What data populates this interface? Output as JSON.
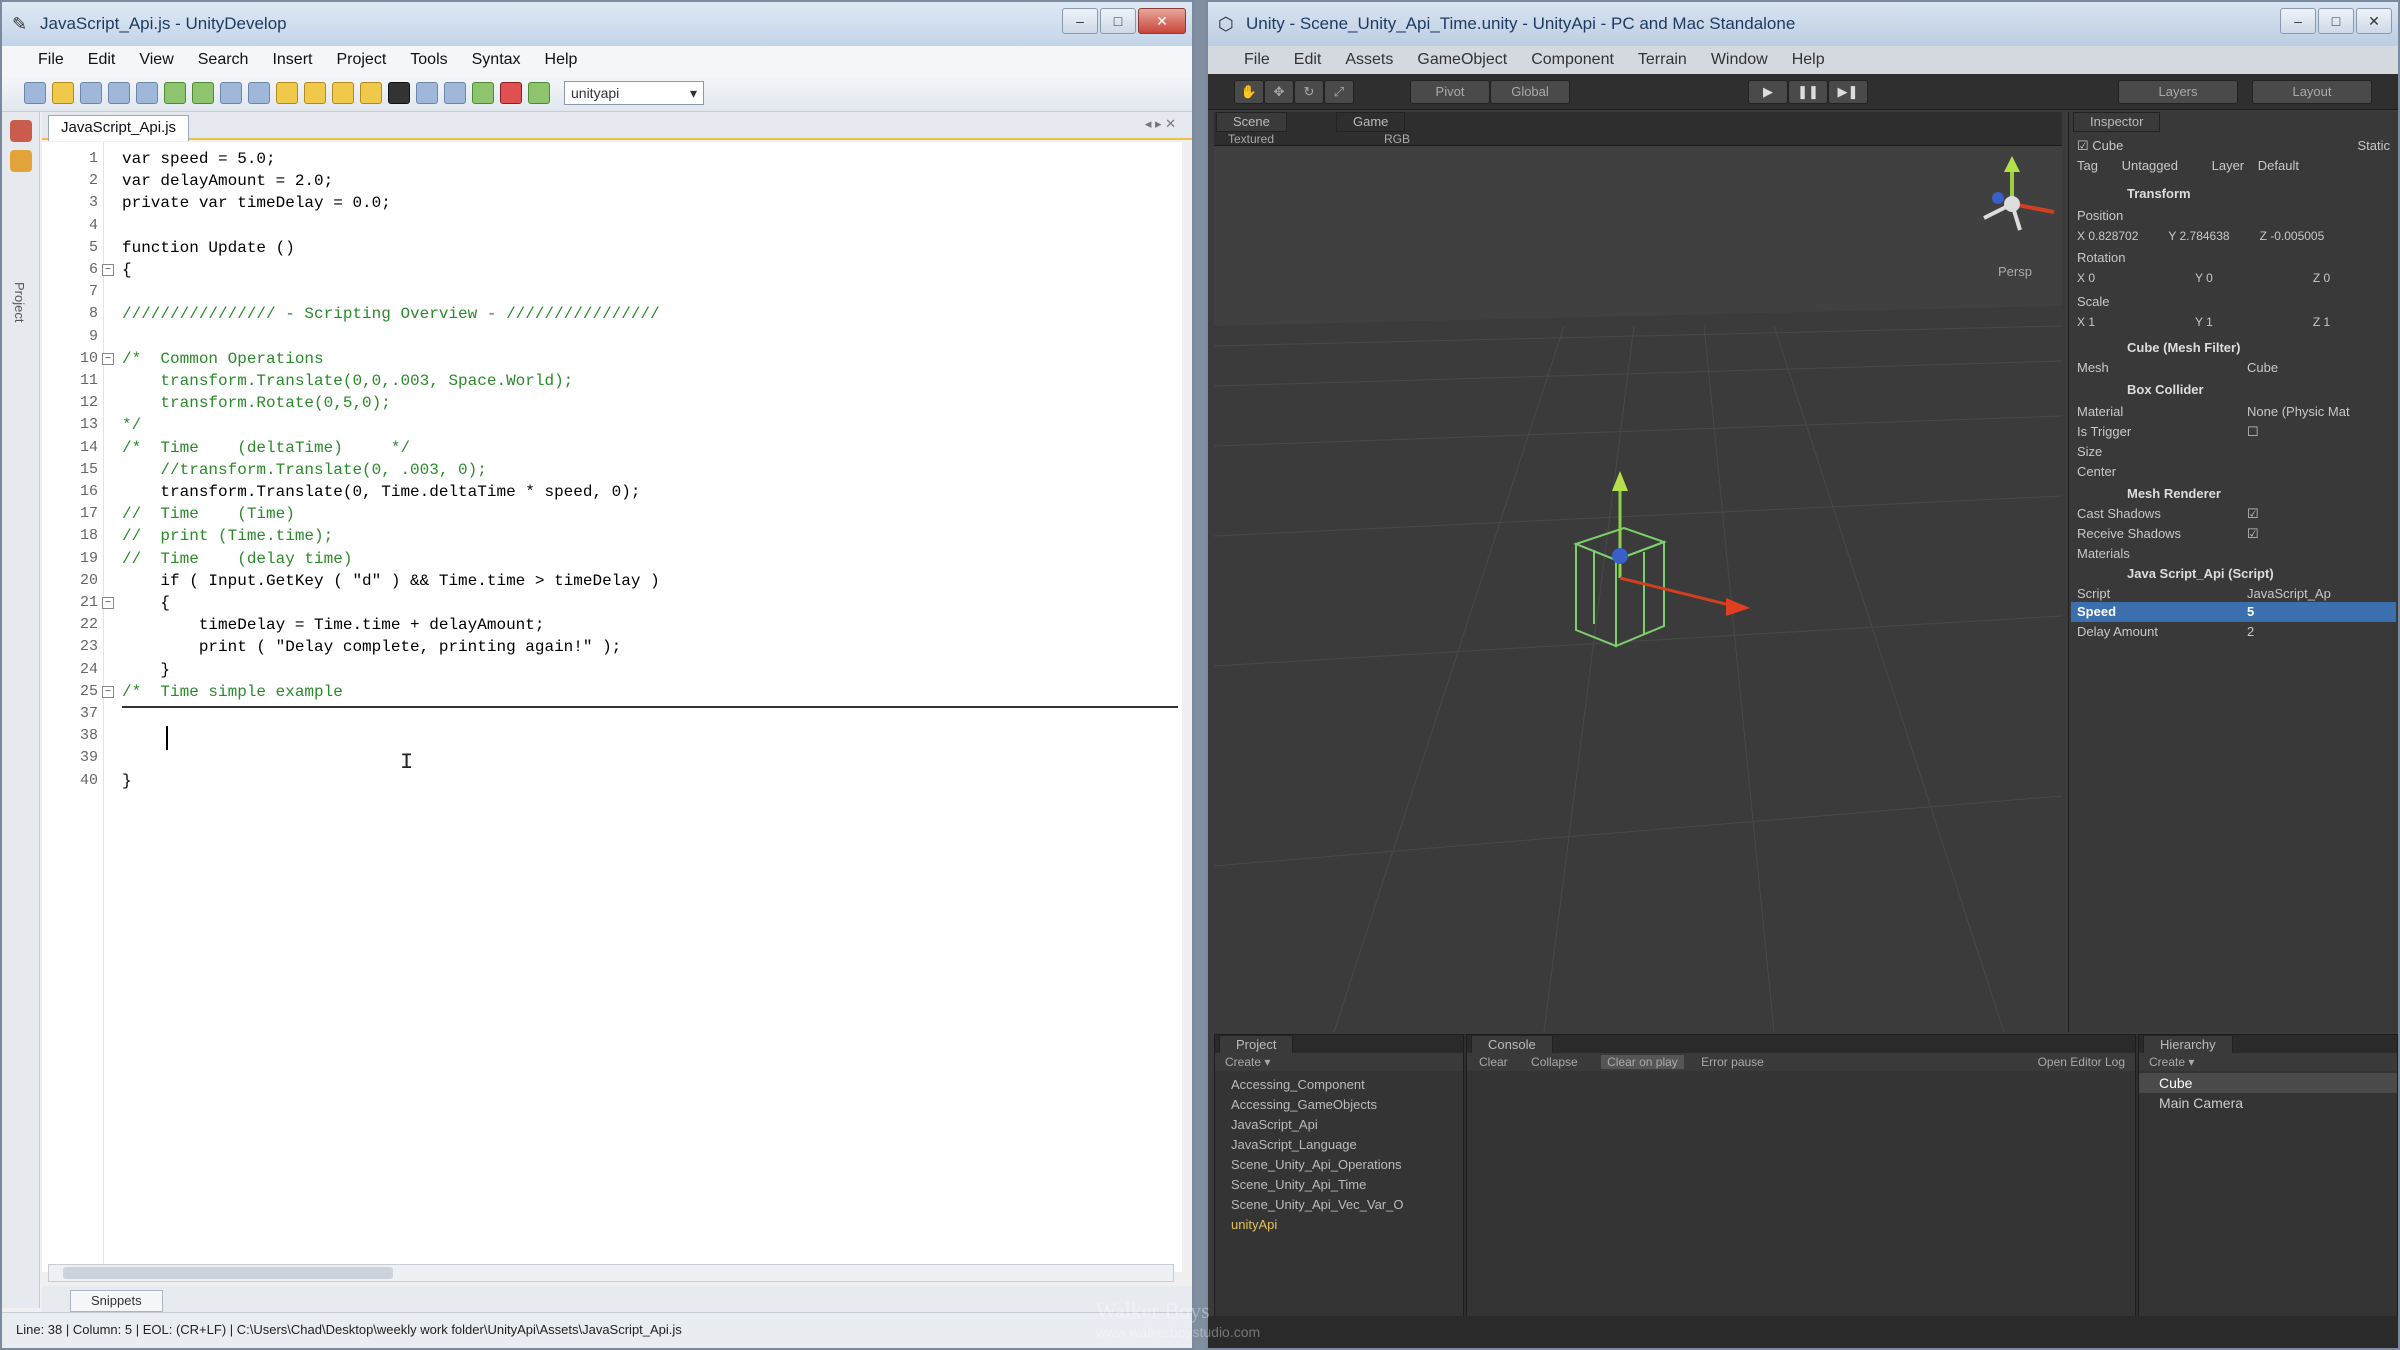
{
  "ultradev": {
    "title": "JavaScript_Api.js - UnityDevelop",
    "menu": [
      "File",
      "Edit",
      "View",
      "Search",
      "Insert",
      "Project",
      "Tools",
      "Syntax",
      "Help"
    ],
    "toolbar_select": "unityapi",
    "tab": "JavaScript_Api.js",
    "side_label": "Project",
    "code_lines": [
      {
        "n": "1",
        "t": "var speed = 5.0;"
      },
      {
        "n": "2",
        "t": "var delayAmount = 2.0;"
      },
      {
        "n": "3",
        "t": "private var timeDelay = 0.0;"
      },
      {
        "n": "4",
        "t": ""
      },
      {
        "n": "5",
        "t": "function Update ()"
      },
      {
        "n": "6",
        "t": "{"
      },
      {
        "n": "7",
        "t": ""
      },
      {
        "n": "8",
        "t": "//////////////// - Scripting Overview - ////////////////"
      },
      {
        "n": "9",
        "t": ""
      },
      {
        "n": "10",
        "t": "/*  Common Operations"
      },
      {
        "n": "11",
        "t": "    transform.Translate(0,0,.003, Space.World);"
      },
      {
        "n": "12",
        "t": "    transform.Rotate(0,5,0);"
      },
      {
        "n": "13",
        "t": "*/"
      },
      {
        "n": "14",
        "t": "/*  Time    (deltaTime)     */"
      },
      {
        "n": "15",
        "t": "    //transform.Translate(0, .003, 0);"
      },
      {
        "n": "16",
        "t": "    transform.Translate(0, Time.deltaTime * speed, 0);"
      },
      {
        "n": "17",
        "t": "//  Time    (Time)"
      },
      {
        "n": "18",
        "t": "//  print (Time.time);"
      },
      {
        "n": "19",
        "t": "//  Time    (delay time)"
      },
      {
        "n": "20",
        "t": "    if ( Input.GetKey ( \"d\" ) && Time.time > timeDelay )"
      },
      {
        "n": "21",
        "t": "    {"
      },
      {
        "n": "22",
        "t": "        timeDelay = Time.time + delayAmount;"
      },
      {
        "n": "23",
        "t": "        print ( \"Delay complete, printing again!\" );"
      },
      {
        "n": "24",
        "t": "    }"
      },
      {
        "n": "25",
        "t": "/*  Time simple example"
      },
      {
        "n": "37",
        "t": ""
      },
      {
        "n": "38",
        "t": ""
      },
      {
        "n": "39",
        "t": ""
      },
      {
        "n": "40",
        "t": "}"
      }
    ],
    "output_tab": "Snippets",
    "status": "Line: 38  |  Column: 5  |  EOL: (CR+LF)  |  C:\\Users\\Chad\\Desktop\\weekly work folder\\UnityApi\\Assets\\JavaScript_Api.js"
  },
  "unity": {
    "title": "Unity - Scene_Unity_Api_Time.unity - UnityApi - PC and Mac Standalone",
    "menu": [
      "File",
      "Edit",
      "Assets",
      "GameObject",
      "Component",
      "Terrain",
      "Window",
      "Help"
    ],
    "toolbar": {
      "pivot": "Pivot",
      "global": "Global",
      "layers": "Layers",
      "layout": "Layout"
    },
    "scene_tabs": [
      "Scene",
      "Game"
    ],
    "scene_controls": [
      "Textured",
      "RGB"
    ],
    "persp_label": "Persp",
    "inspector": {
      "tab": "Inspector",
      "object": "Cube",
      "static": "Static",
      "tag_label": "Tag",
      "tag": "Untagged",
      "layer_label": "Layer",
      "layer": "Default",
      "transform": "Transform",
      "position_label": "Position",
      "position": [
        "X 0.828702",
        "Y 2.784638",
        "Z -0.005005"
      ],
      "rotation_label": "Rotation",
      "rotation": [
        "X 0",
        "Y 0",
        "Z 0"
      ],
      "scale_label": "Scale",
      "scale": [
        "X 1",
        "Y 1",
        "Z 1"
      ],
      "mesh_filter": "Cube (Mesh Filter)",
      "mesh_label": "Mesh",
      "mesh": "Cube",
      "box_collider": "Box Collider",
      "material_label": "Material",
      "material": "None (Physic Mat",
      "trigger_label": "Is Trigger",
      "size_label": "Size",
      "center_label": "Center",
      "mesh_renderer": "Mesh Renderer",
      "cast_label": "Cast Shadows",
      "receive_label": "Receive Shadows",
      "materials_label": "Materials",
      "script_comp": "Java Script_Api (Script)",
      "script_label": "Script",
      "script": "JavaScript_Ap",
      "speed_label": "Speed",
      "speed": "5",
      "delay_label": "Delay Amount",
      "delay": "2"
    },
    "project": {
      "tab": "Project",
      "create": "Create ▾",
      "items": [
        "Accessing_Component",
        "Accessing_GameObjects",
        "JavaScript_Api",
        "JavaScript_Language",
        "Scene_Unity_Api_Operations",
        "Scene_Unity_Api_Time",
        "Scene_Unity_Api_Vec_Var_O",
        "unityApi"
      ]
    },
    "console": {
      "tab": "Console",
      "buttons": [
        "Clear",
        "Collapse",
        "Clear on play",
        "Error pause"
      ],
      "right": "Open Editor Log"
    },
    "hierarchy": {
      "tab": "Hierarchy",
      "create": "Create ▾",
      "items": [
        "Cube",
        "Main Camera"
      ]
    }
  },
  "watermark": {
    "line1": "Walker Boys",
    "line2": "www.walkerboystudio.com"
  }
}
